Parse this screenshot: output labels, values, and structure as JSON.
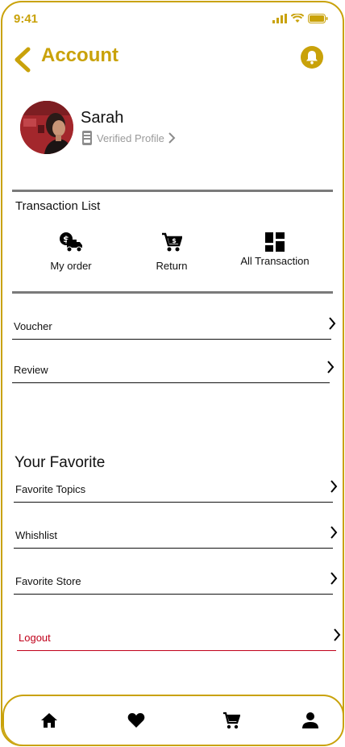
{
  "status": {
    "time": "9:41"
  },
  "header": {
    "title": "Account"
  },
  "profile": {
    "name": "Sarah",
    "verified_label": "Verified Profile"
  },
  "transactions": {
    "title": "Transaction List",
    "items": [
      {
        "label": "My order",
        "icon": "delivery-truck-icon"
      },
      {
        "label": "Return",
        "icon": "shopping-cart-icon"
      },
      {
        "label": "All Transaction",
        "icon": "dashboard-grid-icon"
      }
    ]
  },
  "menu": [
    {
      "label": "Voucher"
    },
    {
      "label": "Review"
    }
  ],
  "favorites": {
    "title": "Your Favorite",
    "items": [
      {
        "label": "Favorite Topics"
      },
      {
        "label": "Whishlist"
      },
      {
        "label": "Favorite Store"
      }
    ]
  },
  "logout": {
    "label": "Logout"
  },
  "colors": {
    "accent": "#c9a20a",
    "danger": "#c0001a",
    "divider": "#7a7a7a"
  },
  "nav": [
    {
      "icon": "home-icon"
    },
    {
      "icon": "heart-icon"
    },
    {
      "icon": "cart-icon"
    },
    {
      "icon": "person-icon"
    }
  ]
}
